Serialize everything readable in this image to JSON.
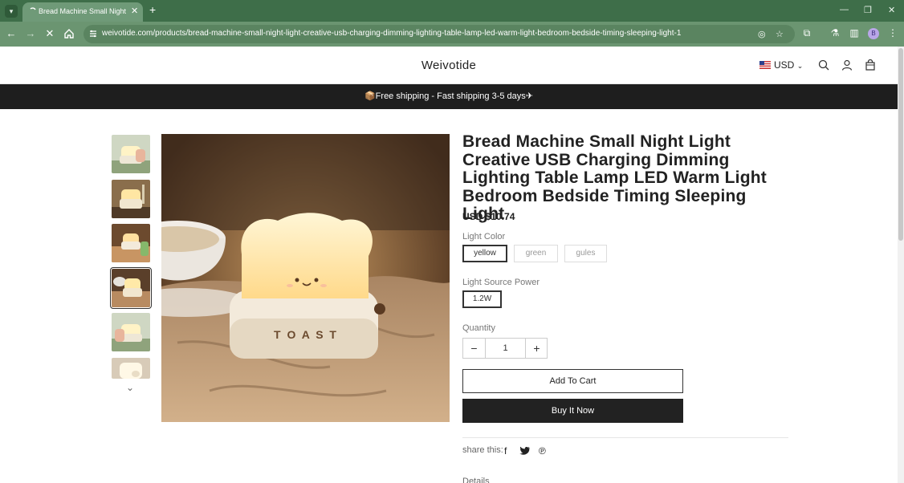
{
  "browser": {
    "tab_title": "Bread Machine Small Night Light",
    "url": "weivotide.com/products/bread-machine-small-night-light-creative-usb-charging-dimming-lighting-table-lamp-led-warm-light-bedroom-bedside-timing-sleeping-light-1",
    "profile_initial": "B"
  },
  "site": {
    "brand": "Weivotide",
    "currency": "USD",
    "announcement": "📦Free shipping - Fast shipping 3-5 days✈"
  },
  "product": {
    "title": "Bread Machine Small Night Light Creative USB Charging Dimming Lighting Table Lamp LED Warm Light Bedroom Bedside Timing Sleeping Light",
    "price": "USD $10.74",
    "image_text": "T O A S T",
    "light_color": {
      "label": "Light Color",
      "options": [
        "yellow",
        "green",
        "gules"
      ],
      "selected": "yellow"
    },
    "light_source_power": {
      "label": "Light Source Power",
      "options": [
        "1.2W"
      ],
      "selected": "1.2W"
    },
    "quantity": {
      "label": "Quantity",
      "value": "1"
    },
    "add_to_cart": "Add To Cart",
    "buy_now": "Buy It Now",
    "share_label": "share this:",
    "details_label": "Details"
  },
  "colors": {
    "tab_bar": "#3e6e49",
    "toolbar": "#6b9571",
    "announcement_bg": "#1e1e1e",
    "buy_now_bg": "#222222"
  }
}
